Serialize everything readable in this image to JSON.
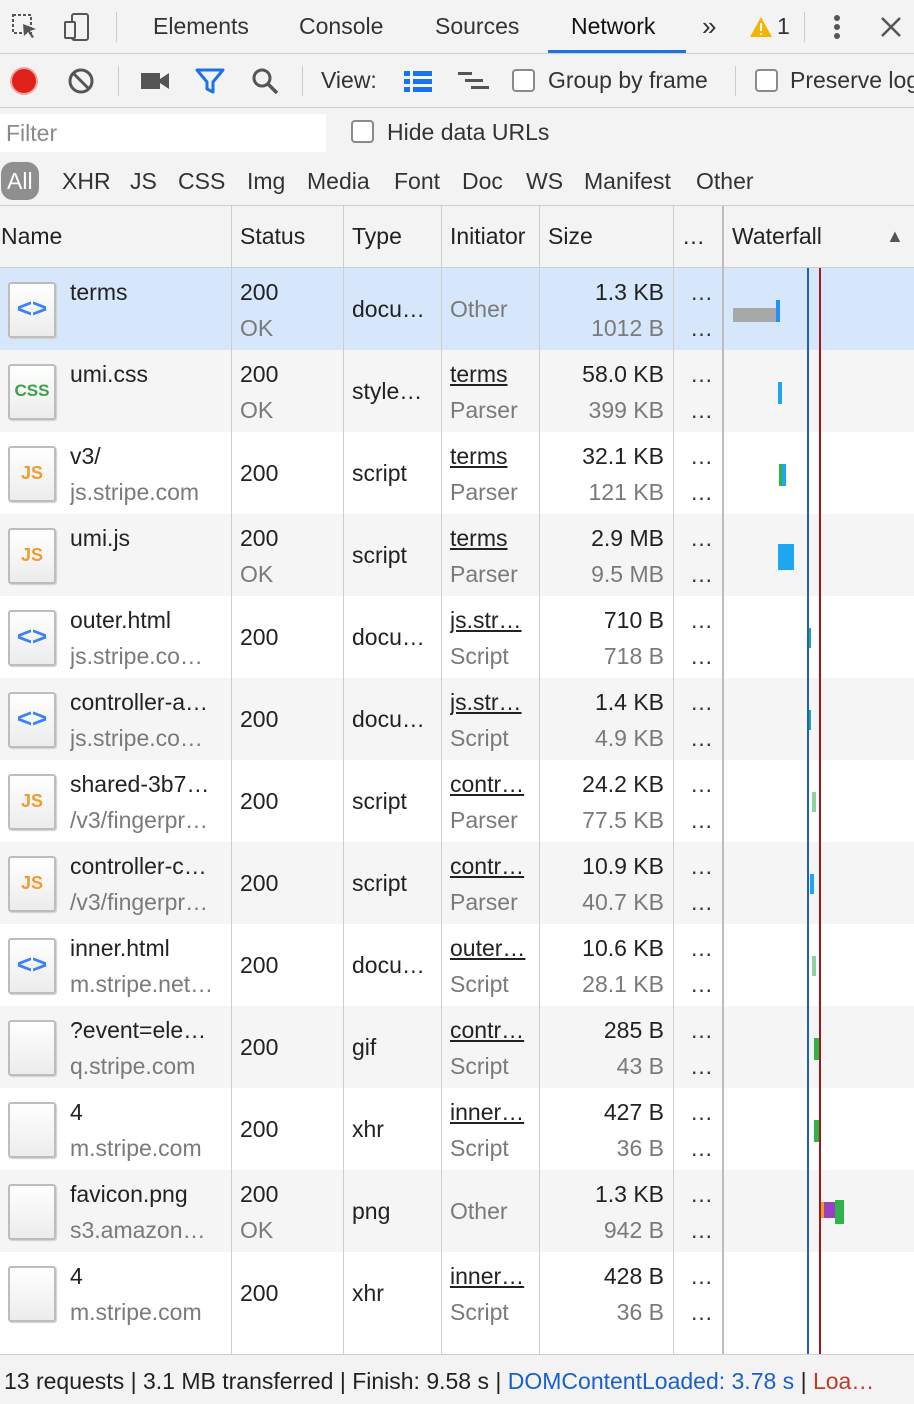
{
  "tabs": {
    "elements": "Elements",
    "console": "Console",
    "sources": "Sources",
    "network": "Network",
    "more": "»",
    "warning_count": "1"
  },
  "toolbar": {
    "view_label": "View:",
    "group_by_frame": "Group by frame",
    "preserve_log": "Preserve log"
  },
  "filter": {
    "placeholder": "Filter",
    "hide_data_urls": "Hide data URLs"
  },
  "types": [
    "All",
    "XHR",
    "JS",
    "CSS",
    "Img",
    "Media",
    "Font",
    "Doc",
    "WS",
    "Manifest",
    "Other"
  ],
  "columns": {
    "name": "Name",
    "status": "Status",
    "type": "Type",
    "initiator": "Initiator",
    "size": "Size",
    "more": "…",
    "waterfall": "Waterfall",
    "sort": "▲"
  },
  "requests": [
    {
      "name": "terms",
      "sub": "",
      "status": "200",
      "status_text": "OK",
      "type": "docu…",
      "initiator": "Other",
      "initiator2": "",
      "size": "1.3 KB",
      "size2": "1012 B",
      "icon": "document-icon"
    },
    {
      "name": "umi.css",
      "sub": "",
      "status": "200",
      "status_text": "OK",
      "type": "style…",
      "initiator": "terms",
      "initiator2": "Parser",
      "size": "58.0 KB",
      "size2": "399 KB",
      "icon": "css-file-icon"
    },
    {
      "name": "v3/",
      "sub": "js.stripe.com",
      "status": "200",
      "status_text": "",
      "type": "script",
      "initiator": "terms",
      "initiator2": "Parser",
      "size": "32.1 KB",
      "size2": "121 KB",
      "icon": "js-file-icon"
    },
    {
      "name": "umi.js",
      "sub": "",
      "status": "200",
      "status_text": "OK",
      "type": "script",
      "initiator": "terms",
      "initiator2": "Parser",
      "size": "2.9 MB",
      "size2": "9.5 MB",
      "icon": "js-file-icon"
    },
    {
      "name": "outer.html",
      "sub": "js.stripe.co…",
      "status": "200",
      "status_text": "",
      "type": "docu…",
      "initiator": "js.str…",
      "initiator2": "Script",
      "size": "710 B",
      "size2": "718 B",
      "icon": "document-icon"
    },
    {
      "name": "controller-a…",
      "sub": "js.stripe.co…",
      "status": "200",
      "status_text": "",
      "type": "docu…",
      "initiator": "js.str…",
      "initiator2": "Script",
      "size": "1.4 KB",
      "size2": "4.9 KB",
      "icon": "document-icon"
    },
    {
      "name": "shared-3b7…",
      "sub": "/v3/fingerpr…",
      "status": "200",
      "status_text": "",
      "type": "script",
      "initiator": "contr…",
      "initiator2": "Parser",
      "size": "24.2 KB",
      "size2": "77.5 KB",
      "icon": "js-file-icon"
    },
    {
      "name": "controller-c…",
      "sub": "/v3/fingerpr…",
      "status": "200",
      "status_text": "",
      "type": "script",
      "initiator": "contr…",
      "initiator2": "Parser",
      "size": "10.9 KB",
      "size2": "40.7 KB",
      "icon": "js-file-icon"
    },
    {
      "name": "inner.html",
      "sub": "m.stripe.net…",
      "status": "200",
      "status_text": "",
      "type": "docu…",
      "initiator": "outer…",
      "initiator2": "Script",
      "size": "10.6 KB",
      "size2": "28.1 KB",
      "icon": "document-icon"
    },
    {
      "name": "?event=ele…",
      "sub": "q.stripe.com",
      "status": "200",
      "status_text": "",
      "type": "gif",
      "initiator": "contr…",
      "initiator2": "Script",
      "size": "285 B",
      "size2": "43 B",
      "icon": "blank-file-icon"
    },
    {
      "name": "4",
      "sub": "m.stripe.com",
      "status": "200",
      "status_text": "",
      "type": "xhr",
      "initiator": "inner…",
      "initiator2": "Script",
      "size": "427 B",
      "size2": "36 B",
      "icon": "blank-file-icon"
    },
    {
      "name": "favicon.png",
      "sub": "s3.amazon…",
      "status": "200",
      "status_text": "OK",
      "type": "png",
      "initiator": "Other",
      "initiator2": "",
      "size": "1.3 KB",
      "size2": "942 B",
      "icon": "blank-file-icon"
    },
    {
      "name": "4",
      "sub": "m.stripe.com",
      "status": "200",
      "status_text": "",
      "type": "xhr",
      "initiator": "inner…",
      "initiator2": "Script",
      "size": "428 B",
      "size2": "36 B",
      "icon": "blank-file-icon"
    }
  ],
  "colors": {
    "selected_row": "#d6e7fb",
    "accent": "#1a73e8",
    "record": "#e0201b",
    "domcontentloaded_line": "#1f5fbf",
    "load_line": "#a01818"
  },
  "status": {
    "requests": "13 requests",
    "transferred": "3.1 MB transferred",
    "finish": "Finish: 9.58 s",
    "dcl": "DOMContentLoaded: 3.78 s",
    "load": "Loa…",
    "sep": "|"
  }
}
